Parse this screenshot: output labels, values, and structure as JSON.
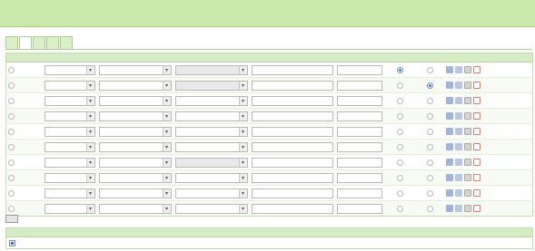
{
  "header": {
    "title": ""
  },
  "tabs": [
    {
      "label": "",
      "active": false
    },
    {
      "label": "",
      "active": true
    },
    {
      "label": "",
      "active": false
    },
    {
      "label": "",
      "active": false
    },
    {
      "label": "",
      "active": false
    }
  ],
  "columns": [
    "",
    "",
    "",
    "",
    "",
    "",
    "",
    "",
    ""
  ],
  "rows": [
    {
      "radio_checked": false,
      "table": "",
      "join_type": "",
      "join_table": "",
      "join_disabled": true,
      "condition": "",
      "alias": "",
      "default_checked": true,
      "secondary_checked": false
    },
    {
      "radio_checked": false,
      "table": "",
      "join_type": "",
      "join_table": "",
      "join_disabled": true,
      "condition": "",
      "alias": "",
      "default_checked": false,
      "secondary_checked": true
    },
    {
      "radio_checked": false,
      "table": "",
      "join_type": "",
      "join_table": "",
      "join_disabled": false,
      "condition": "",
      "alias": "",
      "default_checked": false,
      "secondary_checked": false
    },
    {
      "radio_checked": false,
      "table": "",
      "join_type": "",
      "join_table": "",
      "join_disabled": false,
      "condition": "",
      "alias": "",
      "default_checked": false,
      "secondary_checked": false
    },
    {
      "radio_checked": false,
      "table": "",
      "join_type": "",
      "join_table": "",
      "join_disabled": false,
      "condition": "",
      "alias": "",
      "default_checked": false,
      "secondary_checked": false
    },
    {
      "radio_checked": false,
      "table": "",
      "join_type": "",
      "join_table": "",
      "join_disabled": false,
      "condition": "",
      "alias": "",
      "default_checked": false,
      "secondary_checked": false
    },
    {
      "radio_checked": false,
      "table": "",
      "join_type": "",
      "join_table": "",
      "join_disabled": true,
      "condition": "",
      "alias": "",
      "default_checked": false,
      "secondary_checked": false
    },
    {
      "radio_checked": false,
      "table": "",
      "join_type": "",
      "join_table": "",
      "join_disabled": false,
      "condition": "",
      "alias": "",
      "default_checked": false,
      "secondary_checked": false
    },
    {
      "radio_checked": false,
      "table": "",
      "join_type": "",
      "join_table": "",
      "join_disabled": false,
      "condition": "",
      "alias": "",
      "default_checked": false,
      "secondary_checked": false
    },
    {
      "radio_checked": false,
      "table": "",
      "join_type": "",
      "join_table": "",
      "join_disabled": false,
      "condition": "",
      "alias": "",
      "default_checked": false,
      "secondary_checked": false
    }
  ],
  "icons": {
    "move_right": "arrow-right-icon",
    "move_left": "arrow-left-icon",
    "insert": "insert-row-icon",
    "delete": "delete-row-icon",
    "add": "add-row-icon",
    "checked": "checkbox-icon"
  },
  "add_button": {
    "label": ""
  },
  "bottom": {
    "columns": [
      "",
      ""
    ],
    "row": {
      "checked": true,
      "text": ""
    }
  },
  "colors": {
    "accent": "#c6e8a8",
    "header_bg": "#d6ecc4",
    "delete": "#e07a6a",
    "selection": "#3d6ebe"
  }
}
